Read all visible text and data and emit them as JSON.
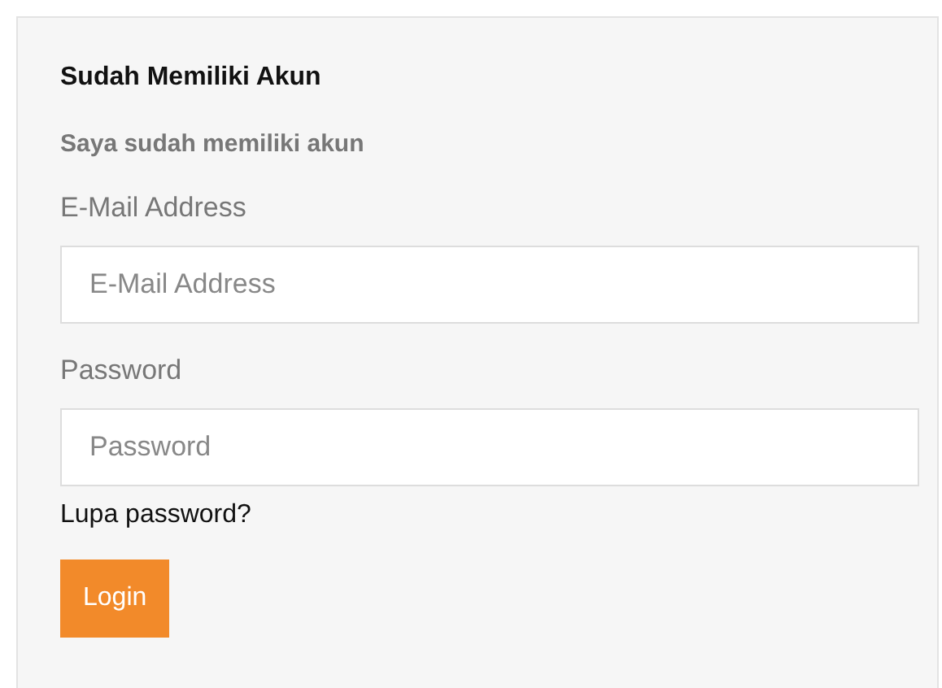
{
  "panel": {
    "title": "Sudah Memiliki Akun",
    "subtitle": "Saya sudah memiliki akun"
  },
  "fields": [
    {
      "label": "E-Mail Address",
      "placeholder": "E-Mail Address"
    },
    {
      "label": "Password",
      "placeholder": "Password"
    }
  ],
  "forgot_link": "Lupa password?",
  "login_button": "Login"
}
